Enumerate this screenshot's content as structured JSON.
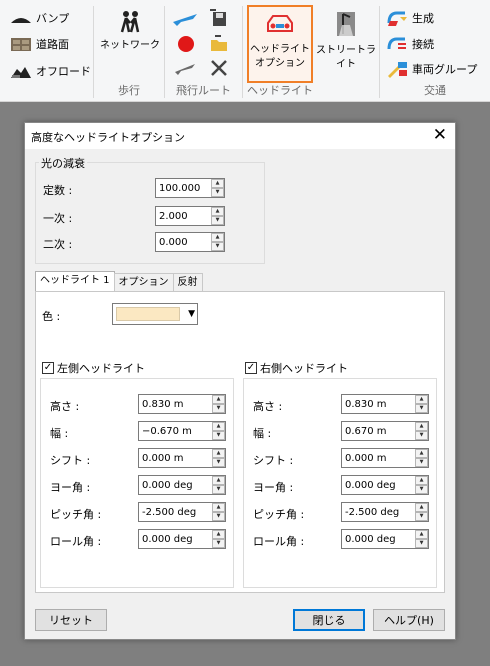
{
  "ribbon": {
    "groups": {
      "road": {
        "items": [
          "バンプ",
          "道路面",
          "オフロード"
        ]
      },
      "walk": {
        "button": "ネットワーク",
        "label": "歩行"
      },
      "flight": {
        "label": "飛行ルート"
      },
      "headlight": {
        "button": "ヘッドライトオプション",
        "label": "ヘッドライト"
      },
      "street": {
        "button": "ストリートライト"
      },
      "traffic": {
        "items": [
          "生成",
          "接続",
          "車両グループ"
        ],
        "label": "交通"
      }
    }
  },
  "dialog": {
    "title": "高度なヘッドライトオプション",
    "attenuation": {
      "legend": "光の減衰",
      "rows": [
        {
          "label": "定数 :",
          "value": "100.000"
        },
        {
          "label": "一次 :",
          "value": "2.000"
        },
        {
          "label": "二次 :",
          "value": "0.000"
        }
      ]
    },
    "tabs": [
      "ヘッドライト 1",
      "オプション",
      "反射"
    ],
    "color_label": "色 :",
    "color_value": "#fbe8c2",
    "left": {
      "label": "左側ヘッドライト",
      "checked": "✓",
      "rows": [
        {
          "label": "高さ :",
          "value": "0.830 m"
        },
        {
          "label": "幅 :",
          "value": "−0.670 m"
        },
        {
          "label": "シフト :",
          "value": "0.000 m"
        },
        {
          "label": "ヨー角 :",
          "value": "0.000 deg"
        },
        {
          "label": "ピッチ角 :",
          "value": "-2.500 deg"
        },
        {
          "label": "ロール角 :",
          "value": "0.000 deg"
        }
      ]
    },
    "right": {
      "label": "右側ヘッドライト",
      "checked": "✓",
      "rows": [
        {
          "label": "高さ :",
          "value": "0.830 m"
        },
        {
          "label": "幅 :",
          "value": "0.670 m"
        },
        {
          "label": "シフト :",
          "value": "0.000 m"
        },
        {
          "label": "ヨー角 :",
          "value": "0.000 deg"
        },
        {
          "label": "ピッチ角 :",
          "value": "-2.500 deg"
        },
        {
          "label": "ロール角 :",
          "value": "0.000 deg"
        }
      ]
    },
    "buttons": {
      "reset": "リセット",
      "close": "閉じる",
      "help": "ヘルプ(H)"
    }
  }
}
